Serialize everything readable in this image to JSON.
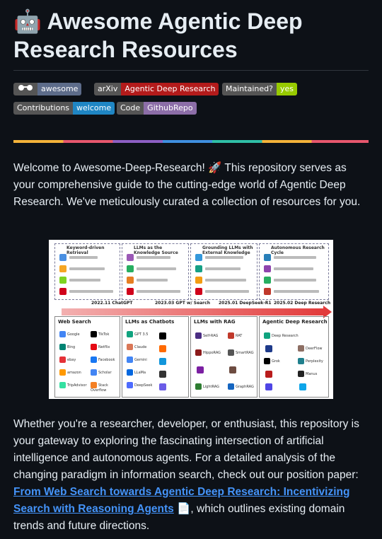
{
  "readme": {
    "title": "🤖 Awesome Agentic Deep Research Resources",
    "badges": [
      {
        "left": "",
        "right": "awesome",
        "right_color": "#5d6c8a",
        "icon": "glasses-icon"
      },
      {
        "left": "arXiv",
        "right": "Agentic Deep Research",
        "right_color": "#b31b1b"
      },
      {
        "left": "Maintained?",
        "right": "yes",
        "right_color": "#97ca00"
      },
      {
        "left": "Contributions",
        "right": "welcome",
        "right_color": "#1f86c4"
      },
      {
        "left": "Code",
        "right": "GithubRepo",
        "right_color": "#8c6ea8"
      }
    ],
    "intro": "Welcome to Awesome-Deep-Research! 🚀 This repository serves as your comprehensive guide to the cutting-edge world of Agentic Deep Research. We've meticulously curated a collection of resources for you.",
    "para2_prefix": "Whether you're a researcher, developer, or enthusiast, this repository is your gateway to exploring the fascinating intersection of artificial intelligence and autonomous agents. For a detailed analysis of the changing paradigm in information search, check out our position paper: ",
    "paper_link": "From Web Search towards Agentic Deep Research: Incentivizing Search with Reasoning Agents",
    "para2_suffix": " 📄, which outlines existing domain trends and future directions."
  },
  "figure": {
    "top_panels": [
      "Keyword-driven Retrieval",
      "LLMs as the Knowledge Source",
      "Grounding LLMs with External Knowledge",
      "Autonomous Research Cycle"
    ],
    "timeline": [
      "2022.11 ChatGPT",
      "2023.03 GPT w/ Search",
      "2025.01 DeepSeek-R1",
      "2025.02 Deep Research"
    ],
    "columns": [
      {
        "title": "Web Search",
        "items": [
          "Google",
          "TikTok",
          "Bing",
          "Netflix",
          "ebay",
          "Facebook",
          "amazon",
          "Scholar",
          "TripAdvisor",
          "Stack Overflow"
        ]
      },
      {
        "title": "LLMs as Chatbots",
        "items": [
          "GPT 3.5",
          "Claude",
          "Gemini",
          "LLaMa",
          "DeepSeek"
        ]
      },
      {
        "title": "LLMs with RAG",
        "items": [
          "Self-RAG",
          "RAT",
          "HippoRAG",
          "SmartRAG",
          "LightRAG",
          "GraphRAG"
        ]
      },
      {
        "title": "Agentic Deep Research",
        "items": [
          "Deep Research",
          "DeerFlow",
          "Grok",
          "Manus",
          "Perplexity"
        ]
      }
    ]
  }
}
